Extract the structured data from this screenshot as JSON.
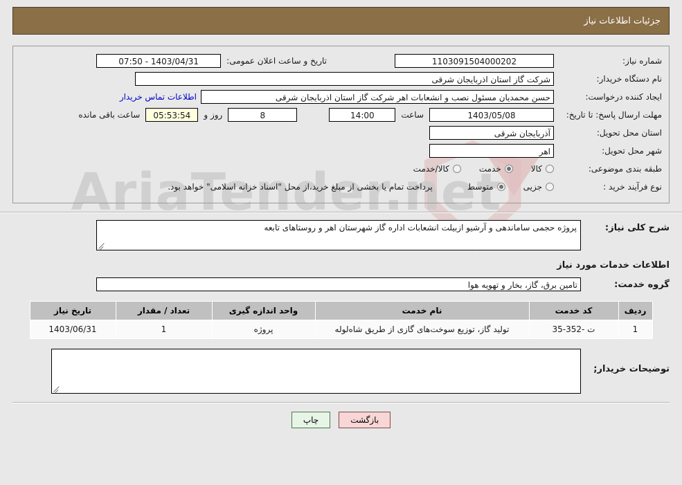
{
  "header": {
    "title": "جزئیات اطلاعات نیاز"
  },
  "colors": {
    "header_bar": "#8b6f47",
    "page_background": "#e8e8e8",
    "link": "#0000cc",
    "countdown_field": "#ffffe0",
    "table_header": "#c0c0c0",
    "print_button": "#e6f5e6",
    "back_button": "#f9d6d6"
  },
  "details": {
    "need_number_label": "شماره نیاز:",
    "need_number_value": "1103091504000202",
    "announce_datetime_label": "تاریخ و ساعت اعلان عمومی:",
    "announce_datetime_value": "1403/04/31 - 07:50",
    "buyer_org_label": "نام دستگاه خریدار:",
    "buyer_org_value": "شرکت گاز استان اذربایجان شرقی",
    "requester_label": "ایجاد کننده درخواست:",
    "requester_value": "حسن محمدیان مسئول نصب و انشعابات اهر  شرکت گاز استان اذربایجان شرقی",
    "contact_link": "اطلاعات تماس خریدار",
    "deadline_label": "مهلت ارسال پاسخ: تا تاریخ:",
    "deadline_date": "1403/05/08",
    "hour_label": "ساعت",
    "deadline_time": "14:00",
    "days_remaining": "8",
    "days_label": "روز و",
    "countdown": "05:53:54",
    "countdown_label": "ساعت باقی مانده",
    "province_label": "استان محل تحویل:",
    "province_value": "آذربایجان شرقی",
    "city_label": "شهر محل تحویل:",
    "city_value": "اهر",
    "category_label": "طبقه بندی موضوعی:",
    "category_options": [
      {
        "label": "کالا",
        "selected": false
      },
      {
        "label": "خدمت",
        "selected": true
      },
      {
        "label": "کالا/خدمت",
        "selected": false
      }
    ],
    "process_type_label": "نوع فرآیند خرید :",
    "process_type_options": [
      {
        "label": "جزیی",
        "selected": false
      },
      {
        "label": "متوسط",
        "selected": true
      }
    ],
    "payment_note": "پرداخت تمام یا بخشی از مبلغ خرید،از محل \"اسناد خزانه اسلامی\" خواهد بود."
  },
  "summary": {
    "label": "شرح کلی نیاز:",
    "value": "پروژه حجمی ساماندهی و آرشیو ازبیلت انشعابات اداره گاز شهرستان  اهر و روستاهای تابعه"
  },
  "services_section": {
    "heading": "اطلاعات خدمات مورد نیاز",
    "group_label": "گروه خدمت:",
    "group_value": "تامین برق، گاز، بخار و تهویه هوا"
  },
  "table": {
    "columns": [
      "ردیف",
      "کد خدمت",
      "نام خدمت",
      "واحد اندازه گیری",
      "تعداد / مقدار",
      "تاریخ نیاز"
    ],
    "rows": [
      {
        "index": "1",
        "code": "ت -352-35",
        "name": "تولید گاز، توزیع سوخت‌های گازی از طریق شاه‌لوله",
        "unit": "پروژه",
        "quantity": "1",
        "date": "1403/06/31"
      }
    ]
  },
  "buyer_notes": {
    "label": "توضیحات خریدار;",
    "value": ""
  },
  "buttons": {
    "print": "چاپ",
    "back": "بازگشت"
  },
  "watermark": {
    "text": "AriaTender.net"
  }
}
